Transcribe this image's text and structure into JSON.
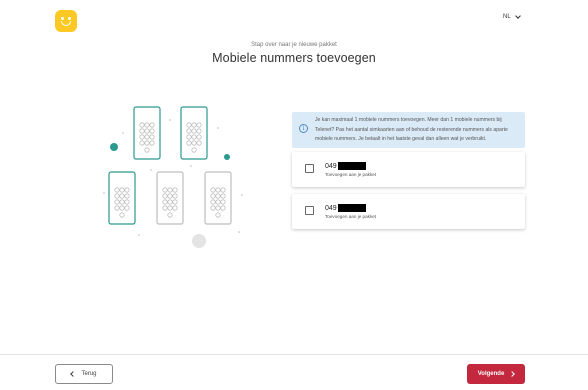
{
  "header": {
    "lang_label": "NL",
    "step_text": "Stap over naar je nieuwe pakket",
    "title": "Mobiele nummers toevoegen"
  },
  "info": {
    "text": "Je kan maximaal 1 mobiele nummers toevoegen. Meer dan 1 mobiele nummers bij Telenet? Pas het aantal simkaarten aan of behoud de resterende nummers als aparte mobiele nummers. Je betaalt in het laatste geval dan alleen wat je verbruikt."
  },
  "numbers": [
    {
      "prefix": "049",
      "label": "Toevoegen aan je pakket"
    },
    {
      "prefix": "049",
      "label": "Toevoegen aan je pakket"
    }
  ],
  "footer": {
    "back_label": "Terug",
    "next_label": "Volgende"
  },
  "colors": {
    "brand_yellow": "#fcc924",
    "accent_red": "#c3283f",
    "info_bg": "#dbeaf7",
    "teal": "#2a9a8e"
  }
}
